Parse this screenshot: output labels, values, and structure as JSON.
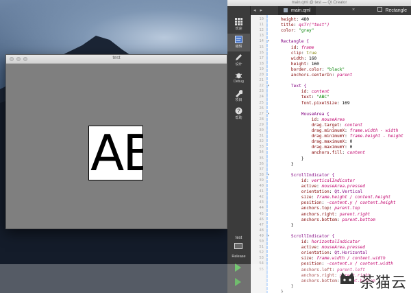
{
  "preview_window": {
    "title": "test",
    "text": "ABC"
  },
  "creator": {
    "title": "main.qml @ test — Qt Creator",
    "tab_file": "main.qml",
    "tab_nav": "◂ ▸",
    "tab_close": "×",
    "tab_type": "Rectangle",
    "modes": [
      {
        "label": "欢迎",
        "icon": "grid-icon"
      },
      {
        "label": "编辑",
        "icon": "edit-icon"
      },
      {
        "label": "设计",
        "icon": "pen-icon"
      },
      {
        "label": "Debug",
        "icon": "bug-icon"
      },
      {
        "label": "项目",
        "icon": "wrench-icon"
      },
      {
        "label": "帮助",
        "icon": "help-icon"
      }
    ],
    "kit_name": "test",
    "kit_mode": "Release",
    "line_numbers": [
      "10",
      "11",
      "12",
      "13",
      "14",
      "15",
      "16",
      "17",
      "18",
      "19",
      "20",
      "21",
      "22",
      "23",
      "24",
      "25",
      "26",
      "27",
      "28",
      "29",
      "30",
      "31",
      "32",
      "33",
      "34",
      "35",
      "36",
      "37",
      "38",
      "39",
      "40",
      "41",
      "42",
      "43",
      "44",
      "45",
      "46",
      "47",
      "48",
      "49",
      "50",
      "51",
      "52",
      "53",
      "54",
      "55"
    ],
    "code": [
      [
        "height",
        ": 480"
      ],
      [
        "title",
        ": ",
        "qsTr(\"test\")"
      ],
      [
        "color",
        ": \"gray\""
      ],
      [
        "",
        ""
      ],
      [
        "Rectangle {",
        ""
      ],
      [
        "    id",
        ": frame"
      ],
      [
        "    clip",
        ": true"
      ],
      [
        "    width",
        ": 160"
      ],
      [
        "    height",
        ": 160"
      ],
      [
        "    border.color",
        ": \"black\""
      ],
      [
        "    anchors.centerIn",
        ": parent"
      ],
      [
        "",
        ""
      ],
      [
        "    Text {",
        ""
      ],
      [
        "        id",
        ": content"
      ],
      [
        "        text",
        ": \"ABC\""
      ],
      [
        "        font.pixelSize",
        ": 169"
      ],
      [
        "",
        ""
      ],
      [
        "        MouseArea {",
        ""
      ],
      [
        "            id",
        ": mouseArea"
      ],
      [
        "            drag.target",
        ": content"
      ],
      [
        "            drag.minimumX",
        ": frame.width - width"
      ],
      [
        "            drag.minimumY",
        ": frame.height - height"
      ],
      [
        "            drag.maximumX",
        ": 0"
      ],
      [
        "            drag.maximumY",
        ": 0"
      ],
      [
        "            anchors.fill",
        ": content"
      ],
      [
        "        }",
        ""
      ],
      [
        "    }",
        ""
      ],
      [
        "",
        ""
      ],
      [
        "    ScrollIndicator {",
        ""
      ],
      [
        "        id",
        ": verticalIndicator"
      ],
      [
        "        active",
        ": mouseArea.pressed"
      ],
      [
        "        orientation",
        ": Qt.Vertical"
      ],
      [
        "        size",
        ": frame.height / content.height"
      ],
      [
        "        position",
        ": -content.y / content.height"
      ],
      [
        "        anchors.top",
        ": parent.top"
      ],
      [
        "        anchors.right",
        ": parent.right"
      ],
      [
        "        anchors.bottom",
        ": parent.bottom"
      ],
      [
        "    }",
        ""
      ],
      [
        "",
        ""
      ],
      [
        "    ScrollIndicator {",
        ""
      ],
      [
        "        id",
        ": horizontalIndicator"
      ],
      [
        "        active",
        ": mouseArea.pressed"
      ],
      [
        "        orientation",
        ": Qt.Horizontal"
      ],
      [
        "        size",
        ": frame.width / content.width"
      ],
      [
        "        position",
        ": -content.x / content.width"
      ],
      [
        "        anchors.left",
        ": parent.left"
      ],
      [
        "        anchors.right",
        ": parent.right"
      ],
      [
        "        anchors.bottom",
        ": parent.bottom"
      ],
      [
        "    }",
        ""
      ],
      [
        "}",
        ""
      ]
    ]
  },
  "watermark": {
    "text": "茶猫云"
  }
}
